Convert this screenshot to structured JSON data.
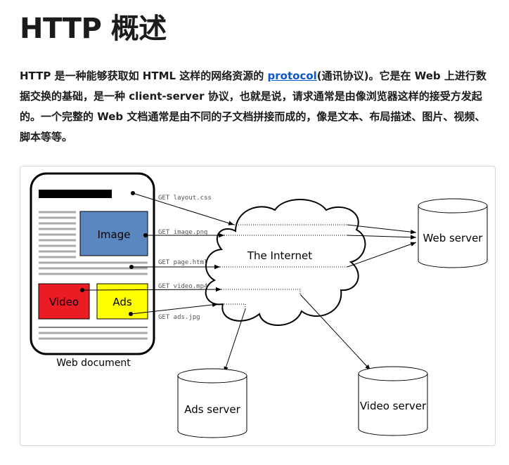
{
  "title": "HTTP 概述",
  "intro": {
    "before_link": "HTTP 是一种能够获取如 HTML 这样的网络资源的 ",
    "link": "protocol",
    "after_link": "(通讯协议)。它是在 Web 上进行数据交换的基础，是一种 client-server 协议，也就是说，请求通常是由像浏览器这样的接受方发起的。一个完整的 Web 文档通常是由不同的子文档拼接而成的，像是文本、布局描述、图片、视频、脚本等等。"
  },
  "diagram": {
    "web_document_label": "Web document",
    "image_label": "Image",
    "video_label": "Video",
    "ads_label": "Ads",
    "internet_label": "The Internet",
    "web_server_label": "Web server",
    "ads_server_label": "Ads server",
    "video_server_label": "Video server",
    "requests": [
      "GET layout.css",
      "GET image.png",
      "GET page.html",
      "GET video.mp4",
      "GET ads.jpg"
    ],
    "colors": {
      "image": "#5b87c1",
      "video": "#ec1c24",
      "ads": "#ffff00"
    }
  }
}
